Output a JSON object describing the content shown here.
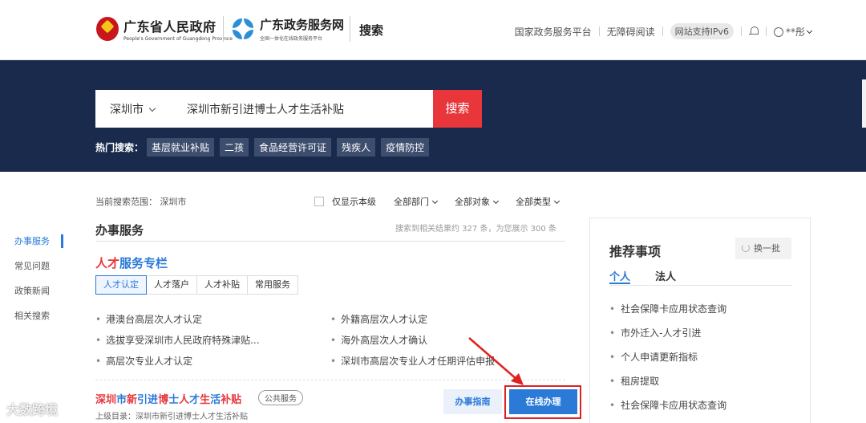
{
  "header": {
    "gov_name": "广东省人民政府",
    "gov_name_en": "People's Government of Guangdong Province",
    "site_name": "广东政务服务网",
    "site_slogan": "全国一体化在线政务服务平台",
    "search_title": "搜索",
    "links": [
      "国家政务服务平台",
      "无障碍阅读"
    ],
    "ipv6": "网站支持IPv6",
    "user": "**彤"
  },
  "search": {
    "city": "深圳市",
    "query": "深圳市新引进博士人才生活补贴",
    "button": "搜索",
    "hot_label": "热门搜索：",
    "hot_tags": [
      "基层就业补贴",
      "二孩",
      "食品经营许可证",
      "残疾人",
      "疫情防控"
    ]
  },
  "left_nav": [
    "办事服务",
    "常见问题",
    "政策新闻",
    "相关搜索"
  ],
  "filters": {
    "scope": "当前搜索范围：  深圳市",
    "only_level": "仅显示本级",
    "dept": "全部部门",
    "target": "全部对象",
    "type": "全部类型"
  },
  "main": {
    "section_title": "办事服务",
    "result_count": "搜索到相关结果约 327 条，为您展示 300 条",
    "column_title_red": "人才",
    "column_title_blue": "服务专栏",
    "tabs": [
      "人才认定",
      "人才落户",
      "人才补贴",
      "常用服务"
    ],
    "items_left": [
      "港澳台高层次人才认定",
      "选拔享受深圳市人民政府特殊津贴...",
      "高层次专业人才认定"
    ],
    "items_right": [
      "外籍高层次人才认定",
      "海外高层次人才确认",
      "深圳市高层次专业人才任期评估申报"
    ],
    "result": {
      "title_parts": [
        "深圳",
        "市",
        "新",
        "引进",
        "博",
        "士",
        "人",
        "才",
        "生",
        "活",
        "补贴"
      ],
      "badge": "公共服务",
      "category": "上级目录：深圳市新引进博士人才生活补贴",
      "guide_button": "办事指南",
      "online_button": "在线办理"
    }
  },
  "recommend": {
    "title": "推荐事项",
    "refresh": "换一批",
    "tabs": [
      "个人",
      "法人"
    ],
    "items": [
      "社会保障卡应用状态查询",
      "市外迁入-人才引进",
      "个人申请更新指标",
      "租房提取",
      "社会保障卡应用状态查询"
    ]
  },
  "watermark": "大数跨境",
  "colors": {
    "navy": "#1a2a4c",
    "red": "#e8363b",
    "blue": "#2b7ad8"
  }
}
